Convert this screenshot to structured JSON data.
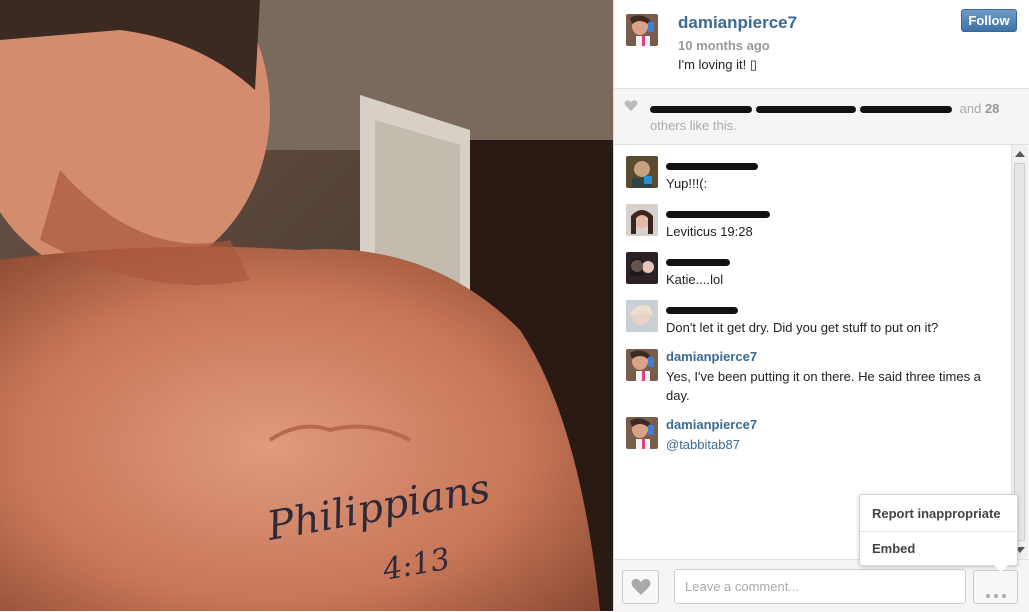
{
  "post": {
    "username": "damianpierce7",
    "time": "10 months ago",
    "caption": "I'm loving it! ▯",
    "follow_label": "Follow"
  },
  "likes": {
    "and_text": "and",
    "count": "28",
    "suffix": "others like this."
  },
  "comments": [
    {
      "username": "",
      "text": "Yup!!!(:"
    },
    {
      "username": "",
      "text": "Leviticus 19:28"
    },
    {
      "username": "",
      "text": "Katie....lol"
    },
    {
      "username": "",
      "text": "Don't let it get dry. Did you get stuff to put on it?"
    },
    {
      "username": "damianpierce7",
      "text": "Yes, I've been putting it on there. He said three times a day."
    },
    {
      "username": "damianpierce7",
      "text": "@tabbitab87"
    }
  ],
  "footer": {
    "comment_placeholder": "Leave a comment..."
  },
  "menu": {
    "items": [
      "Report inappropriate",
      "Embed"
    ]
  },
  "photo": {
    "tattoo_line1": "Philippians",
    "tattoo_line2": "4:13"
  },
  "colors": {
    "link": "#3a6a93",
    "follow_button": "#4d7fb3",
    "muted": "#999999"
  },
  "icons": [
    "heart-icon",
    "more-dots-icon"
  ]
}
